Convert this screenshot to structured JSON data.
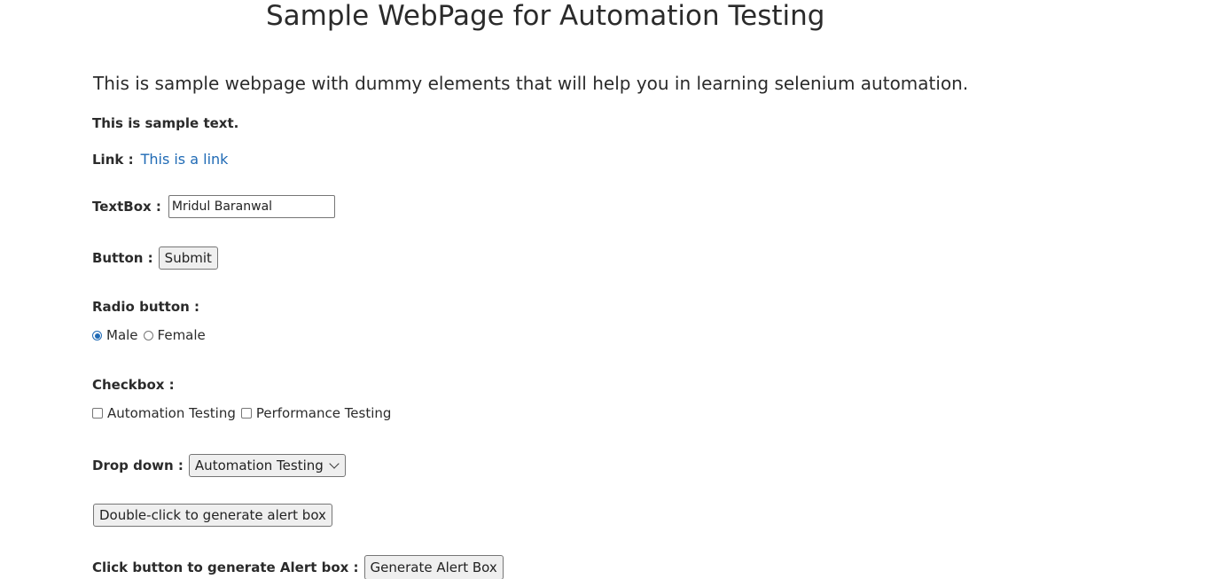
{
  "header": {
    "title": "Sample WebPage for Automation Testing",
    "intro": "This is sample webpage with dummy elements that will help you in learning selenium automation."
  },
  "sample_text": "This is sample text.",
  "link_row": {
    "label": "Link :",
    "link_text": "This is a link"
  },
  "textbox_row": {
    "label": "TextBox :",
    "value": "Mridul Baranwal"
  },
  "button_row": {
    "label": "Button :",
    "button_label": "Submit"
  },
  "radio_row": {
    "label": "Radio button :",
    "options": [
      {
        "label": "Male",
        "checked": true
      },
      {
        "label": "Female",
        "checked": false
      }
    ]
  },
  "checkbox_row": {
    "label": "Checkbox :",
    "options": [
      {
        "label": "Automation Testing",
        "checked": false
      },
      {
        "label": "Performance Testing",
        "checked": false
      }
    ]
  },
  "dropdown_row": {
    "label": "Drop down :",
    "selected": "Automation Testing"
  },
  "double_click": {
    "button_label": "Double-click to generate alert box"
  },
  "alert_row": {
    "label": "Click button to generate Alert box :",
    "button_label": "Generate Alert Box"
  },
  "colors": {
    "link": "#1f6ab5",
    "text": "#2b2b2b",
    "button_bg": "#efefef"
  }
}
